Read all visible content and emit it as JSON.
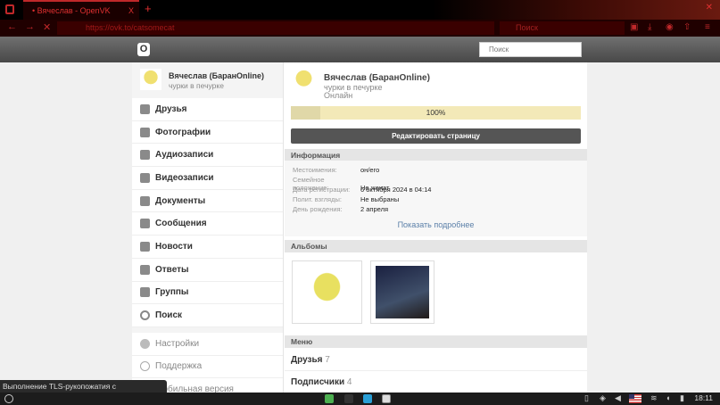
{
  "browser": {
    "tab_title": "Вячеслав - OpenVK",
    "url": "https://ovk.to/catsomecat",
    "search_placeholder": "Поиск",
    "new_tab": "+",
    "close": "X"
  },
  "site": {
    "logo": "O",
    "search_placeholder": "Поиск"
  },
  "sidebar": {
    "user_name": "Вячеслав (БаранOnline)",
    "user_status": "чурки в печурке",
    "items": [
      {
        "label": "Друзья"
      },
      {
        "label": "Фотографии"
      },
      {
        "label": "Аудиозаписи"
      },
      {
        "label": "Видеозаписи"
      },
      {
        "label": "Документы"
      },
      {
        "label": "Сообщения"
      },
      {
        "label": "Новости"
      },
      {
        "label": "Ответы"
      },
      {
        "label": "Группы"
      },
      {
        "label": "Поиск"
      }
    ],
    "secondary": [
      {
        "label": "Настройки"
      },
      {
        "label": "Поддержка"
      },
      {
        "label": "Мобильная версия"
      }
    ]
  },
  "profile": {
    "name": "Вячеслав (БаранOnline)",
    "status": "чурки в печурке",
    "online": "Онлайн",
    "completion_percent": 100,
    "completion_label": "100%",
    "edit_button": "Редактировать страницу"
  },
  "info": {
    "title": "Информация",
    "rows": [
      {
        "k": "Местоимения:",
        "v": "он/его"
      },
      {
        "k": "Семейное положение:",
        "v": "Не женат"
      },
      {
        "k": "Дата регистрации:",
        "v": "6 октября 2024 в 04:14"
      },
      {
        "k": "Полит. взгляды:",
        "v": "Не выбраны"
      },
      {
        "k": "День рождения:",
        "v": "2 апреля"
      }
    ],
    "more": "Показать подробнее"
  },
  "albums": {
    "title": "Альбомы"
  },
  "menu": {
    "title": "Меню",
    "items": [
      {
        "label": "Друзья",
        "count": "7"
      },
      {
        "label": "Подписчики",
        "count": "4"
      }
    ]
  },
  "statusbar": {
    "tooltip": "Выполнение TLS-рукопожатия с abs.twimg.com...",
    "clock": "18:11"
  }
}
